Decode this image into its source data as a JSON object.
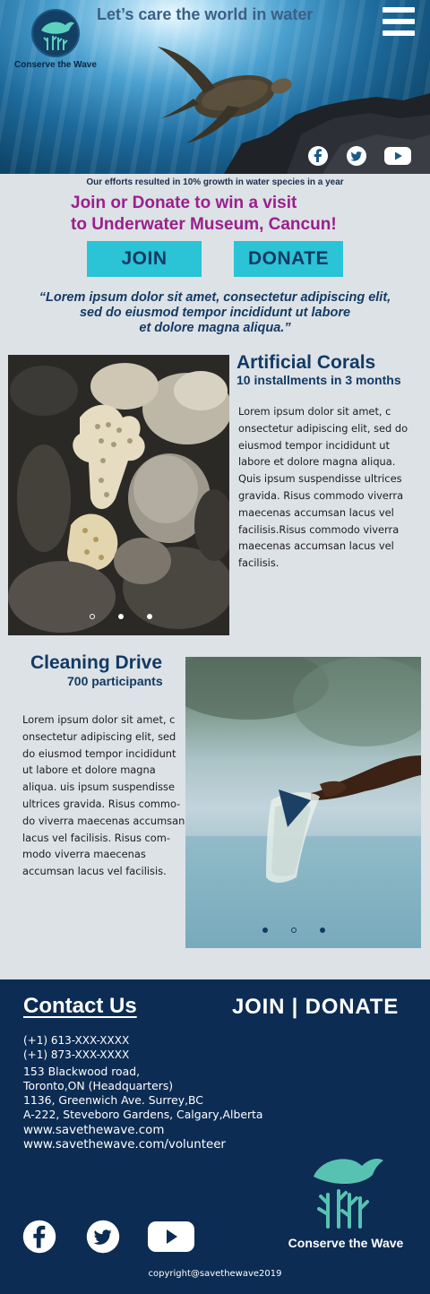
{
  "hero": {
    "tagline": "Let’s care the world in water",
    "logo_caption": "Conserve the Wave",
    "social": [
      "facebook-icon",
      "twitter-icon",
      "youtube-icon"
    ]
  },
  "stat_line": "Our efforts resulted in 10% growth in water species in a year",
  "cta": {
    "line1": "Join or Donate to win a visit",
    "line2": "to Underwater Museum, Cancun!",
    "join_label": "JOIN",
    "donate_label": "DONATE"
  },
  "quote": {
    "line1": "“Lorem ipsum dolor sit amet, consectetur adipiscing elit,",
    "line2": "sed do eiusmod tempor incididunt ut labore",
    "line3": "et dolore magna aliqua.”"
  },
  "features": [
    {
      "title": "Artificial Corals",
      "subtitle": "10 installments in 3 months",
      "body": [
        "Lorem ipsum dolor sit amet, c",
        "onsectetur adipiscing elit, sed do",
        "eiusmod tempor incididunt ut",
        "labore et dolore magna aliqua.",
        "Quis ipsum suspendisse ultrices",
        "gravida. Risus commodo viverra",
        "maecenas accumsan lacus vel",
        "facilisis.Risus commodo viverra",
        "maecenas accumsan lacus vel",
        "facilisis."
      ],
      "carousel_active": 0
    },
    {
      "title": "Cleaning Drive",
      "subtitle": "700 participants",
      "body": [
        "Lorem ipsum dolor sit amet, c",
        "onsectetur adipiscing elit, sed",
        "do eiusmod tempor incididunt",
        "ut labore et dolore magna",
        "aliqua. uis ipsum suspendisse",
        "ultrices gravida. Risus commo-",
        "do viverra maecenas accumsan",
        "lacus vel facilisis. Risus com-",
        "modo viverra maecenas",
        "accumsan lacus vel facilisis."
      ],
      "carousel_active": 1
    }
  ],
  "footer": {
    "contact_title": "Contact Us",
    "cta": "JOIN | DONATE",
    "phones": [
      "(+1) 613-XXX-XXXX",
      "(+1) 873-XXX-XXXX"
    ],
    "addresses": [
      "153 Blackwood road,",
      "Toronto,ON (Headquarters)",
      "1136, Greenwich Ave. Surrey,BC",
      "A-222, Steveboro Gardens, Calgary,Alberta"
    ],
    "links": [
      "www.savethewave.com",
      "www.savethewave.com/volunteer"
    ],
    "social": [
      "facebook-icon",
      "twitter-icon",
      "youtube-icon"
    ],
    "logo_caption": "Conserve the Wave",
    "copyright": "copyright@savethewave2019"
  },
  "colors": {
    "navy": "#0c2c53",
    "accent_cyan": "#2bc3d6",
    "cta_magenta": "#9b1f8c",
    "page_bg": "#dde2e7"
  }
}
